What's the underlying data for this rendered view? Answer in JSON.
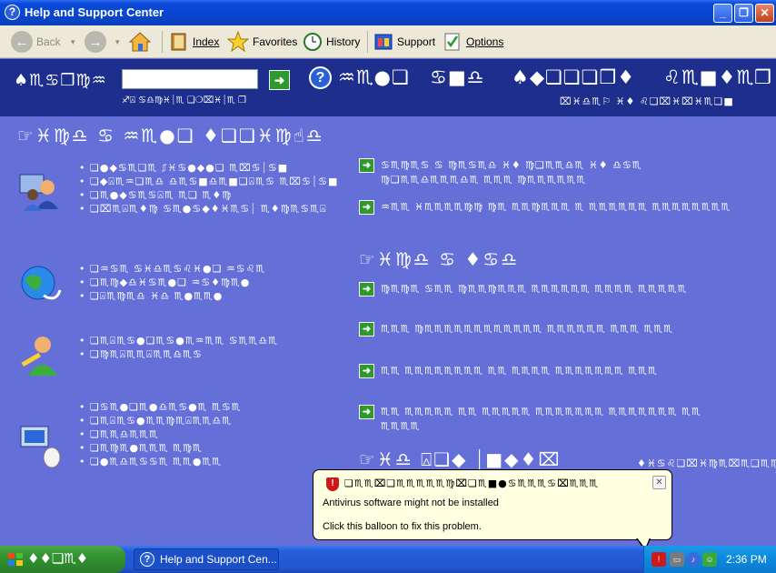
{
  "window": {
    "title": "Help and Support Center"
  },
  "toolbar": {
    "back": "Back",
    "index": "Index",
    "favorites": "Favorites",
    "history": "History",
    "support": "Support",
    "options": "Options"
  },
  "search": {
    "label": "♠♏♋❒♍♒",
    "value": "",
    "sub": "♐⍓ ♋♎♍♓⏐♏ ❏❍⌧♓⏐♏ ❐"
  },
  "header_nav": {
    "help": "♒♏●❏",
    "support": "♋■♎",
    "options": "♠◆❏❏❏❒♦",
    "customize": "♌♏■♦♏❒",
    "sub": "⌧♓♎♏⚐ ♓♦ ♌❏⌧♓⌧♓♏❏■"
  },
  "content": {
    "heading_left": "☞♓♍♎ ♋ ♒♏●❏ ♦❏❏♓♍☝♎",
    "heading_tasks": "☞♓♍♎ ♋ ♦♋♎",
    "heading_did": "☞♓♎ ⍓❏◆ ⏐■◆♦⌧",
    "heading_did_more": "♦♓♋♌❏⌧♓♍♏⌧♏❑♏♍♦♏",
    "sections": [
      {
        "icon": "people-help-icon",
        "items": [
          "❏●◆♋♏❏♏ ⎎♓♋●◆●❏ ♏⌧♋⏐♋■",
          "❏◆⍓♏♒❏♏♎ ♎♏♋■♎♏■❏⍓♏♋ ♏⌧♋⏐♋■",
          "❏♏●◆♋♏♋⍓♏ ♏❏ ♏♦♍",
          "❏⌧♏⍓♏♦♍ ♋♏●♋◆♦♓♏♋⏐ ♏♦♍♏♋♏⍓"
        ]
      },
      {
        "icon": "globe-network-icon",
        "items": [
          "❏♒♋♏ ♋♓♎♏♋♌♓●❏ ♒♋♌♏",
          "❏♏♍◆♎♓♋♏●❏ ♒♋♦♍♏●",
          "❏⍓♏♍♏♎ ♓♎ ♏●♏♏●"
        ]
      },
      {
        "icon": "paint-user-icon",
        "items": [
          "❏♏⍓♏♋●❏♏♋●♏♒♏♏ ♋♏♏♎♏",
          "❏♍♏⍓♏♏⍓♏♏♎♏♋"
        ]
      },
      {
        "icon": "computer-mouse-icon",
        "items": [
          "❏♋♏●❏♏●♎♏♋●♏ ♏♋♏",
          "❏♏⍓♏♋●♏♏♍♏⍓♏♏♎♏",
          "❏♏♏♎♏♏♏",
          "❏♏♍♏●♏♏♏ ♏♍♏",
          "❏●♏♎♏♋♋♏ ♏♏●♏♏"
        ]
      }
    ],
    "tasks": [
      "♋♏♍♏♋ ♋ ♍♏♋♏♎ ♓♦ ♍❏♏♏♎♏ ♓♦ ♎♋♏ ♍❏♏♏♎♏♏♏♎♏ ♏♏♏ ♍♏♏♏♏♏♏",
      "♒♏♏ ♓♏♏♏♏♍♍ ♍♏ ♏♏♍♏♏♏ ♏ ♏♏♏♏♏♏ ♏♏♏♏♏♏♏♏",
      "♍♏♍♏ ♋♏♏ ♍♏♏♍♏♏♏ ♏♏♏♏♏♏ ♏♏♏♏ ♏♏♏♏♏",
      "♏♏♏ ♍♏♏♏♏♏♏♏♏♏♏♏♏ ♏♏♏♏♏♏ ♏♏♏ ♏♏♏",
      "♏♏ ♏♏♏♏♏♏♏♏ ♏♏ ♏♏♏♏ ♏♏♏♏♏♏♏ ♏♏♏",
      "♏♏ ♏♏♏♏♏ ♏♏ ♏♏♏♏♏ ♏♏♏♏♏♏♏ ♏♏♏♏♏♏♏ ♏♏ ♏♏♏♏"
    ]
  },
  "balloon": {
    "title": "❏♏♏⌧❏♏♏♏♏♏♍⌧❏♏■●♋♏♏♏♋⌧♏♏♏",
    "line1": "Antivirus software might not be installed",
    "line2": "Click this balloon to fix this problem."
  },
  "taskbar": {
    "start": "♦♦❏♏♦",
    "task_button": "Help and Support Cen...",
    "clock": "2:36 PM"
  },
  "colors": {
    "titlebar": "#0a48d8",
    "content_bg": "#6470d8",
    "searchbar_bg": "#1d2e8c",
    "go_green": "#2e9a2e",
    "balloon_bg": "#ffffe1"
  }
}
